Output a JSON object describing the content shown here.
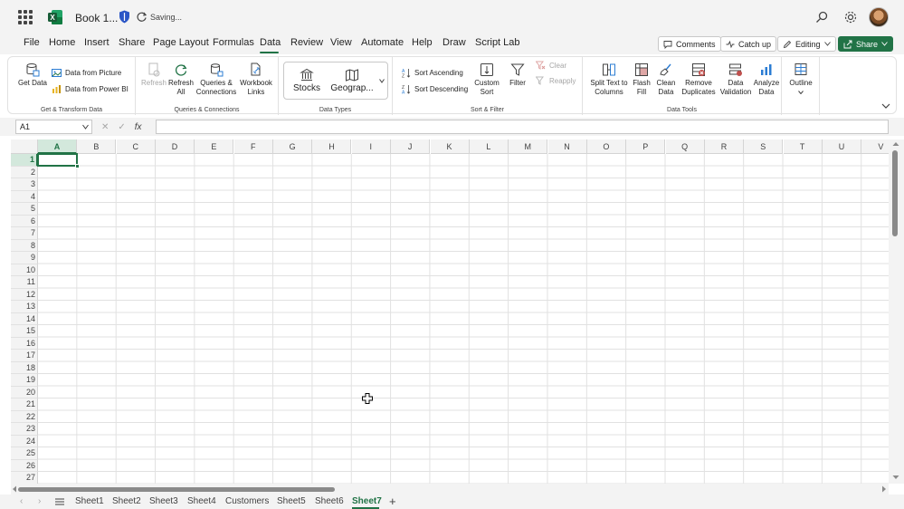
{
  "titlebar": {
    "book_title": "Book 1...",
    "saving": "Saving..."
  },
  "menu": [
    "File",
    "Home",
    "Insert",
    "Share",
    "Page Layout",
    "Formulas",
    "Data",
    "Review",
    "View",
    "Automate",
    "Help",
    "Draw",
    "Script Lab"
  ],
  "active_menu": "Data",
  "right_buttons": {
    "comments": "Comments",
    "catchup": "Catch up",
    "editing": "Editing",
    "share": "Share"
  },
  "ribbon": {
    "get_data": "Get Data",
    "data_from_picture": "Data from Picture",
    "data_from_powerbi": "Data from Power BI",
    "group_get_transform": "Get & Transform Data",
    "refresh": "Refresh",
    "refresh_all_1": "Refresh",
    "refresh_all_2": "All",
    "queries_1": "Queries &",
    "queries_2": "Connections",
    "workbook_1": "Workbook",
    "workbook_2": "Links",
    "group_queries": "Queries & Connections",
    "stocks": "Stocks",
    "geography": "Geograp...",
    "group_datatypes": "Data Types",
    "sort_asc": "Sort Ascending",
    "sort_desc": "Sort Descending",
    "custom_sort_1": "Custom",
    "custom_sort_2": "Sort",
    "filter": "Filter",
    "clear": "Clear",
    "reapply": "Reapply",
    "group_sortfilter": "Sort & Filter",
    "split_1": "Split Text to",
    "split_2": "Columns",
    "flash_1": "Flash",
    "flash_2": "Fill",
    "clean_1": "Clean",
    "clean_2": "Data",
    "remove_1": "Remove",
    "remove_2": "Duplicates",
    "validation_1": "Data",
    "validation_2": "Validation",
    "analyze_1": "Analyze",
    "analyze_2": "Data",
    "group_datatools": "Data Tools",
    "outline": "Outline"
  },
  "formula_bar": {
    "name_box": "A1",
    "fx": "fx",
    "formula": ""
  },
  "columns": [
    "A",
    "B",
    "C",
    "D",
    "E",
    "F",
    "G",
    "H",
    "I",
    "J",
    "K",
    "L",
    "M",
    "N",
    "O",
    "P",
    "Q",
    "R",
    "S",
    "T",
    "U",
    "V"
  ],
  "rows": [
    "1",
    "2",
    "3",
    "4",
    "5",
    "6",
    "7",
    "8",
    "9",
    "10",
    "11",
    "12",
    "13",
    "14",
    "15",
    "16",
    "17",
    "18",
    "19",
    "20",
    "21",
    "22",
    "23",
    "24",
    "25",
    "26",
    "27"
  ],
  "active_cell": "A1",
  "sheets": [
    "Sheet1",
    "Sheet2",
    "Sheet3",
    "Sheet4",
    "Customers",
    "Sheet5",
    "Sheet6",
    "Sheet7"
  ],
  "active_sheet": "Sheet7",
  "colors": {
    "accent": "#217346",
    "chrome": "#f3f3f3"
  }
}
